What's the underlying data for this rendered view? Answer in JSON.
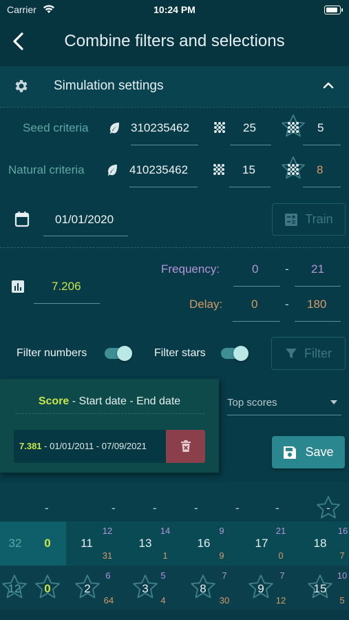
{
  "status_bar": {
    "carrier": "Carrier",
    "time": "10:24 PM"
  },
  "header": {
    "title": "Combine filters and selections"
  },
  "settings": {
    "title": "Simulation settings",
    "seed": {
      "label": "Seed criteria",
      "value": "310235462",
      "count": "25",
      "stars": "5"
    },
    "natural": {
      "label": "Natural criteria",
      "value": "410235462",
      "count": "15",
      "stars": "8"
    },
    "date": "01/01/2020",
    "train_label": "Train",
    "score_value": "7.206",
    "frequency": {
      "label": "Frequency:",
      "min": "0",
      "max": "21"
    },
    "delay": {
      "label": "Delay:",
      "min": "0",
      "max": "180"
    },
    "filter_numbers_label": "Filter numbers",
    "filter_stars_label": "Filter stars",
    "filter_label": "Filter",
    "range_separator": "-"
  },
  "score_panel": {
    "header_score": "Score",
    "header_rest": " - Start date - End date",
    "entry_score": "7.381",
    "entry_rest": " - 01/01/2011 - 07/09/2021"
  },
  "top_scores": {
    "selected": "Top scores"
  },
  "save_label": "Save",
  "grid": {
    "dashes": [
      "-",
      "-",
      "-",
      "-",
      "-",
      "-",
      "-"
    ],
    "row1": {
      "first": "32",
      "second": "0",
      "cells": [
        {
          "num": "11",
          "top": "12",
          "bottom": "31"
        },
        {
          "num": "13",
          "top": "14",
          "bottom": "1"
        },
        {
          "num": "16",
          "top": "9",
          "bottom": "9"
        },
        {
          "num": "17",
          "top": "21",
          "bottom": "0"
        },
        {
          "num": "18",
          "top": "16",
          "bottom": "7"
        }
      ]
    },
    "row2": {
      "first": "12",
      "second": "0",
      "cells": [
        {
          "num": "2",
          "top": "6",
          "bottom": "64"
        },
        {
          "num": "3",
          "top": "5",
          "bottom": "4"
        },
        {
          "num": "8",
          "top": "7",
          "bottom": "30"
        },
        {
          "num": "9",
          "top": "7",
          "bottom": "12"
        },
        {
          "num": "15",
          "top": "10",
          "bottom": "5"
        }
      ]
    }
  },
  "colors": {
    "background": "#073b47",
    "accent_teal": "#2a8790",
    "score_yellow": "#c8e64a",
    "frequency_purple": "#b496d8",
    "delay_orange": "#d49b6a",
    "delete_red": "#8a3f4a"
  },
  "icons": [
    "wifi-icon",
    "battery-icon",
    "back-chevron-icon",
    "gear-icon",
    "chevron-up-icon",
    "leaf-icon",
    "dots-grid-icon",
    "star-icon",
    "calendar-icon",
    "calculator-icon",
    "bar-chart-icon",
    "filter-icon",
    "trash-icon",
    "save-icon",
    "dropdown-arrow-icon"
  ]
}
